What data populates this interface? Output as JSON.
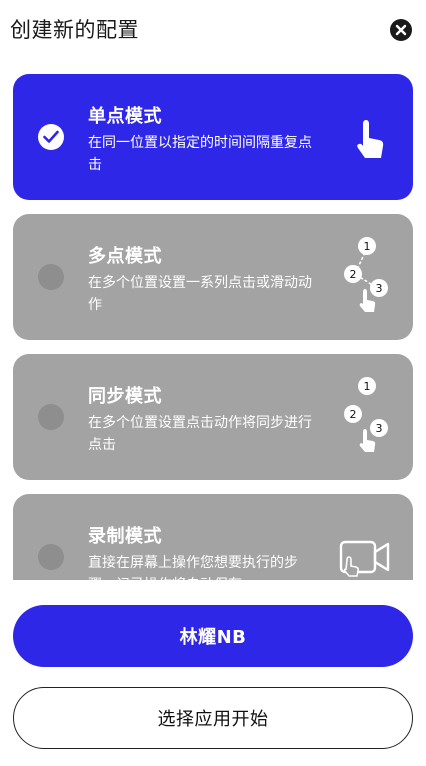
{
  "header": {
    "title": "创建新的配置"
  },
  "modes": [
    {
      "name": "单点模式",
      "desc": "在同一位置以指定的时间间隔重复点击",
      "selected": true
    },
    {
      "name": "多点模式",
      "desc": "在多个位置设置一系列点击或滑动动作",
      "selected": false
    },
    {
      "name": "同步模式",
      "desc": "在多个位置设置点击动作将同步进行点击",
      "selected": false
    },
    {
      "name": "录制模式",
      "desc": "直接在屏幕上操作您想要执行的步骤，记录操作将自动保存",
      "selected": false
    }
  ],
  "step_labels": [
    "1",
    "2",
    "3"
  ],
  "actions": {
    "primary_label": "林耀NB",
    "secondary_label": "选择应用开始"
  },
  "colors": {
    "accent": "#2f27e8",
    "card_inactive": "#a3a3a3"
  }
}
